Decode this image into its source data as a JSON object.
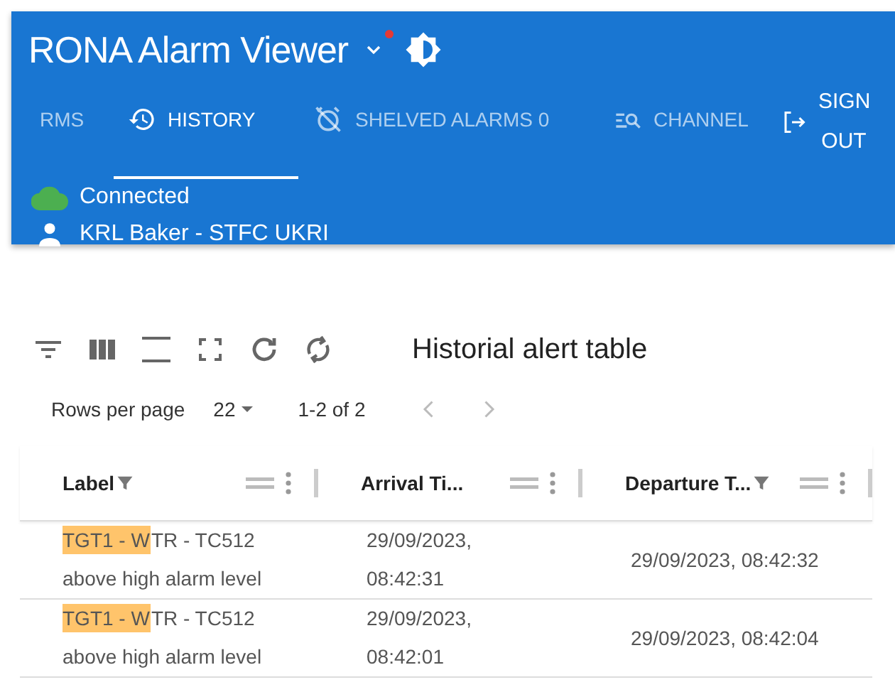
{
  "app_bar": {
    "title": "RONA Alarm Viewer",
    "notification": true,
    "tabs": [
      {
        "label": "RMS",
        "kind": "plain",
        "selected": false
      },
      {
        "label": "HISTORY",
        "kind": "history",
        "selected": true
      },
      {
        "label": "SHELVED ALARMS 0",
        "kind": "shelved",
        "selected": false
      },
      {
        "label": "CHANNEL",
        "kind": "channel",
        "selected": false
      }
    ],
    "sign_out": "SIGN OUT",
    "connection": "Connected",
    "user": "KRL Baker - STFC UKRI"
  },
  "table_title": "Historial alert table",
  "pagination": {
    "rows_per_page_label": "Rows per page",
    "rows_per_page": "22",
    "range": "1-2 of 2"
  },
  "columns": [
    {
      "label": "Label",
      "filtered": true
    },
    {
      "label": "Arrival Ti...",
      "filtered": false
    },
    {
      "label": "Departure T...",
      "filtered": true
    }
  ],
  "rows": [
    {
      "label_match": "TGT1 - W",
      "label_rest": "TR - TC512 above high alarm level",
      "arrival": "29/09/2023, 08:42:31",
      "departure": "29/09/2023, 08:42:32"
    },
    {
      "label_match": "TGT1 - W",
      "label_rest": "TR - TC512 above high alarm level",
      "arrival": "29/09/2023, 08:42:01",
      "departure": "29/09/2023, 08:42:04"
    }
  ]
}
